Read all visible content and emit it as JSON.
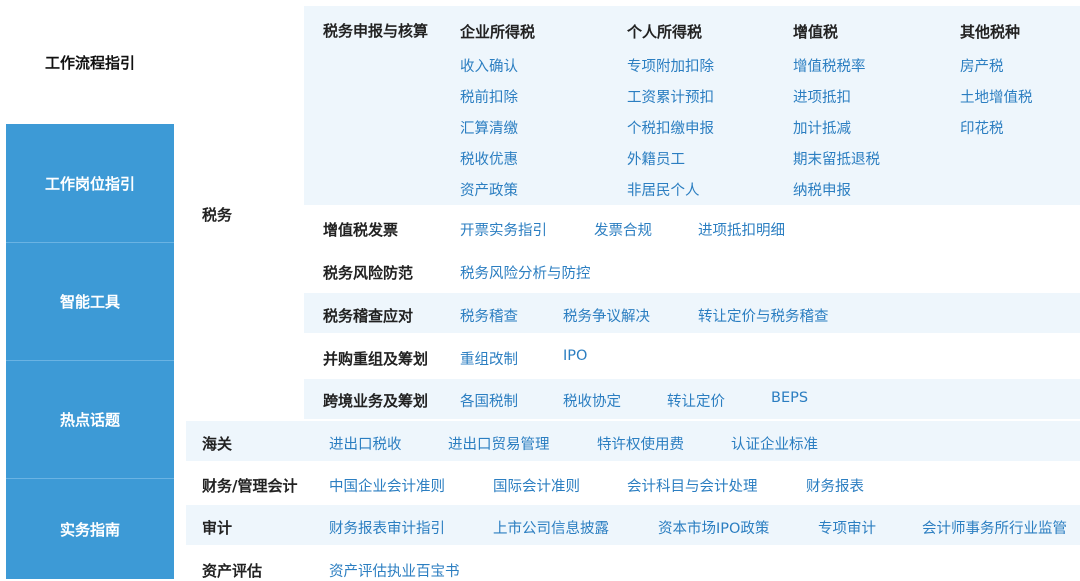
{
  "sidebar": {
    "items": [
      {
        "label": "工作流程指引",
        "active": true
      },
      {
        "label": "工作岗位指引",
        "active": false
      },
      {
        "label": "智能工具",
        "active": false
      },
      {
        "label": "热点话题",
        "active": false
      },
      {
        "label": "实务指南",
        "active": false
      }
    ]
  },
  "tax": {
    "label": "税务",
    "declaration": {
      "label": "税务申报与核算",
      "columns": [
        {
          "header": "企业所得税",
          "links": [
            "收入确认",
            "税前扣除",
            "汇算清缴",
            "税收优惠",
            "资产政策"
          ]
        },
        {
          "header": "个人所得税",
          "links": [
            "专项附加扣除",
            "工资累计预扣",
            "个税扣缴申报",
            "外籍员工",
            "非居民个人"
          ]
        },
        {
          "header": "增值税",
          "links": [
            "增值税税率",
            "进项抵扣",
            "加计抵减",
            "期末留抵退税",
            "纳税申报"
          ]
        },
        {
          "header": "其他税种",
          "links": [
            "房产税",
            "土地增值税",
            "印花税"
          ]
        }
      ]
    },
    "rows": [
      {
        "label": "增值税发票",
        "links": [
          "开票实务指引",
          "发票合规",
          "进项抵扣明细"
        ]
      },
      {
        "label": "税务风险防范",
        "links": [
          "税务风险分析与防控"
        ]
      },
      {
        "label": "税务稽查应对",
        "links": [
          "税务稽查",
          "税务争议解决",
          "转让定价与税务稽查"
        ]
      },
      {
        "label": "并购重组及筹划",
        "links": [
          "重组改制",
          "IPO"
        ]
      },
      {
        "label": "跨境业务及筹划",
        "links": [
          "各国税制",
          "税收协定",
          "转让定价",
          "BEPS"
        ]
      }
    ]
  },
  "categories": [
    {
      "label": "海关",
      "links": [
        "进出口税收",
        "进出口贸易管理",
        "特许权使用费",
        "认证企业标准"
      ]
    },
    {
      "label": "财务/管理会计",
      "links": [
        "中国企业会计准则",
        "国际会计准则",
        "会计科目与会计处理",
        "财务报表"
      ]
    },
    {
      "label": "审计",
      "links": [
        "财务报表审计指引",
        "上市公司信息披露",
        "资本市场IPO政策",
        "专项审计",
        "会计师事务所行业监管"
      ]
    },
    {
      "label": "资产评估",
      "links": [
        "资产评估执业百宝书"
      ]
    }
  ],
  "colors": {
    "sidebar_blue": "#3d9ad6",
    "link_blue": "#2b7ec1",
    "shade": "#eef6fc"
  }
}
